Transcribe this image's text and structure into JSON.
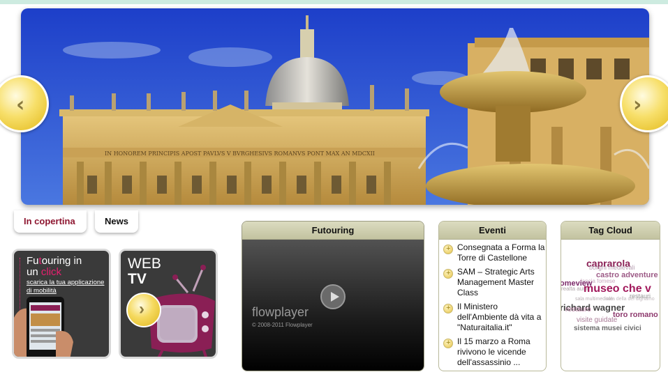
{
  "hero": {
    "prev_symbol": "‹",
    "next_symbol": "›",
    "inscription": "IN HONOREM PRINCIPIS APOST PAVLVS V BVRGHESIVS ROMANVS PONT MAX AN MDCXII"
  },
  "tabs": [
    {
      "label": "In copertina",
      "active": true
    },
    {
      "label": "News",
      "active": false
    }
  ],
  "promo_app": {
    "title_a": "Fu",
    "title_b": "t",
    "title_c": "ouring in",
    "title_d": "un ",
    "title_e": "click",
    "sub": "scarica la tua applicazione di mobilità"
  },
  "promo_tv": {
    "line1": "WEB",
    "line2": "TV",
    "arrow": "›"
  },
  "video": {
    "title": "Futouring",
    "logo": "flowplayer",
    "copyright": "© 2008-2011 Flowplayer"
  },
  "events": {
    "title": "Eventi",
    "items": [
      "Consegnata a Forma la Torre di Castellone",
      "SAM – Strategic Arts Management Master Class",
      "Il Ministero dell'Ambiente dà vita a \"Naturaitalia.it\"",
      "Il 15 marzo a Roma rivivono le vicende dell'assassinio ..."
    ]
  },
  "tag_cloud": {
    "title": "Tag Cloud",
    "tags": [
      {
        "text": "caprarola",
        "color": "#8a1f55"
      },
      {
        "text": "borghi medievali",
        "color": "#b9a2b4"
      },
      {
        "text": "castro adventure",
        "color": "#9c5a86"
      },
      {
        "text": "lancia fomese",
        "color": "#c9a9bf"
      },
      {
        "text": "omeview",
        "color": "#7c2a6a"
      },
      {
        "text": "realta aum",
        "color": "#b0a6aa"
      },
      {
        "text": "museo che v",
        "color": "#a1185b"
      },
      {
        "text": "sala multimediale",
        "color": "#b9b0b4"
      },
      {
        "text": "sala della del dignamo",
        "color": "#c4bcc0"
      },
      {
        "text": "restauri",
        "color": "#999999"
      },
      {
        "text": "richard wagner",
        "color": "#444444"
      },
      {
        "text": "restauro",
        "color": "#b67b9f"
      },
      {
        "text": "toro romano",
        "color": "#8e3a6e"
      },
      {
        "text": "visite guidate",
        "color": "#a97a96"
      },
      {
        "text": "sistema musei civici",
        "color": "#6a6a6a"
      }
    ]
  },
  "colors": {
    "accent_magenta": "#e6206f",
    "tab_active": "#8e1630",
    "panel_header": "#c8c8a6"
  }
}
